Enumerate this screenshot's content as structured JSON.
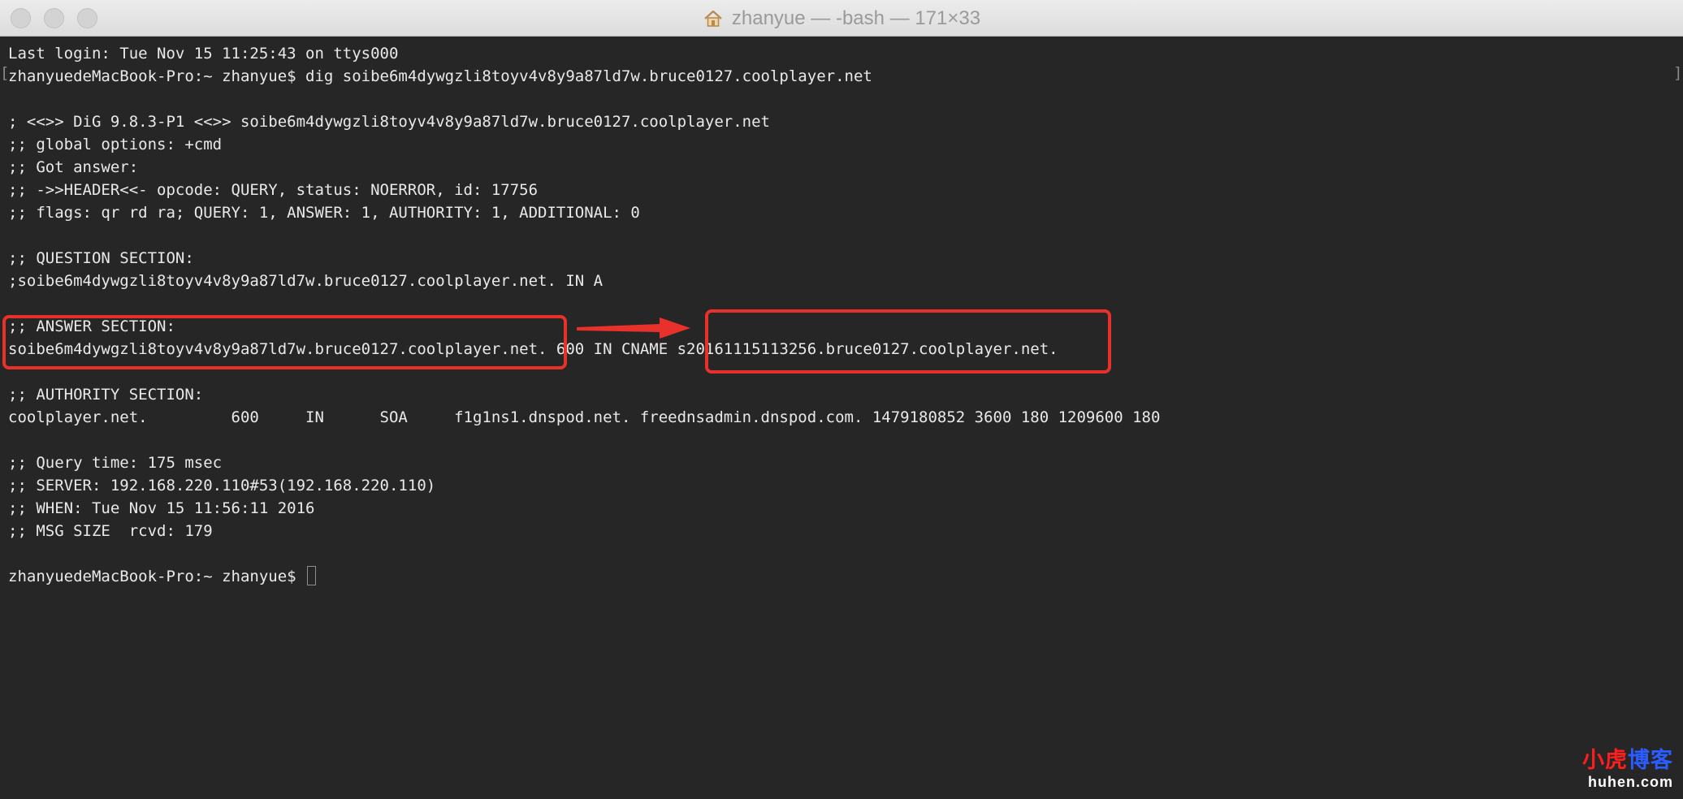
{
  "window": {
    "title": "zhanyue — -bash — 171×33",
    "title_icon": "home-icon",
    "controls": [
      "close",
      "minimize",
      "maximize"
    ]
  },
  "terminal": {
    "lines": [
      "Last login: Tue Nov 15 11:25:43 on ttys000",
      "zhanyuedeMacBook-Pro:~ zhanyue$ dig soibe6m4dywgzli8toyv4v8y9a87ld7w.bruce0127.coolplayer.net",
      "",
      "; <<>> DiG 9.8.3-P1 <<>> soibe6m4dywgzli8toyv4v8y9a87ld7w.bruce0127.coolplayer.net",
      ";; global options: +cmd",
      ";; Got answer:",
      ";; ->>HEADER<<- opcode: QUERY, status: NOERROR, id: 17756",
      ";; flags: qr rd ra; QUERY: 1, ANSWER: 1, AUTHORITY: 1, ADDITIONAL: 0",
      "",
      ";; QUESTION SECTION:",
      ";soibe6m4dywgzli8toyv4v8y9a87ld7w.bruce0127.coolplayer.net. IN A",
      "",
      ";; ANSWER SECTION:",
      "soibe6m4dywgzli8toyv4v8y9a87ld7w.bruce0127.coolplayer.net. 600 IN CNAME s20161115113256.bruce0127.coolplayer.net.",
      "",
      ";; AUTHORITY SECTION:",
      "coolplayer.net.         600     IN      SOA     f1g1ns1.dnspod.net. freednsadmin.dnspod.com. 1479180852 3600 180 1209600 180",
      "",
      ";; Query time: 175 msec",
      ";; SERVER: 192.168.220.110#53(192.168.220.110)",
      ";; WHEN: Tue Nov 15 11:56:11 2016",
      ";; MSG SIZE  rcvd: 179",
      "",
      "zhanyuedeMacBook-Pro:~ zhanyue$ "
    ],
    "prompt_line_index": 23
  },
  "annotations": {
    "color": "#e8312a"
  },
  "watermark": {
    "brand_red": "小虎",
    "brand_blue": "博客",
    "url": "huhen.com"
  }
}
